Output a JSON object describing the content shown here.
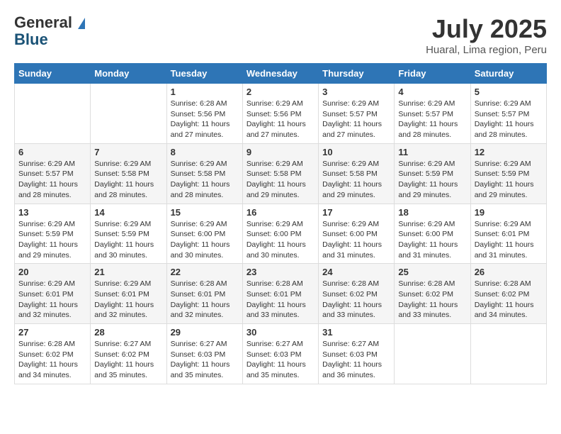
{
  "header": {
    "logo_general": "General",
    "logo_blue": "Blue",
    "month_year": "July 2025",
    "location": "Huaral, Lima region, Peru"
  },
  "weekdays": [
    "Sunday",
    "Monday",
    "Tuesday",
    "Wednesday",
    "Thursday",
    "Friday",
    "Saturday"
  ],
  "weeks": [
    [
      {
        "day": "",
        "info": ""
      },
      {
        "day": "",
        "info": ""
      },
      {
        "day": "1",
        "info": "Sunrise: 6:28 AM\nSunset: 5:56 PM\nDaylight: 11 hours and 27 minutes."
      },
      {
        "day": "2",
        "info": "Sunrise: 6:29 AM\nSunset: 5:56 PM\nDaylight: 11 hours and 27 minutes."
      },
      {
        "day": "3",
        "info": "Sunrise: 6:29 AM\nSunset: 5:57 PM\nDaylight: 11 hours and 27 minutes."
      },
      {
        "day": "4",
        "info": "Sunrise: 6:29 AM\nSunset: 5:57 PM\nDaylight: 11 hours and 28 minutes."
      },
      {
        "day": "5",
        "info": "Sunrise: 6:29 AM\nSunset: 5:57 PM\nDaylight: 11 hours and 28 minutes."
      }
    ],
    [
      {
        "day": "6",
        "info": "Sunrise: 6:29 AM\nSunset: 5:57 PM\nDaylight: 11 hours and 28 minutes."
      },
      {
        "day": "7",
        "info": "Sunrise: 6:29 AM\nSunset: 5:58 PM\nDaylight: 11 hours and 28 minutes."
      },
      {
        "day": "8",
        "info": "Sunrise: 6:29 AM\nSunset: 5:58 PM\nDaylight: 11 hours and 28 minutes."
      },
      {
        "day": "9",
        "info": "Sunrise: 6:29 AM\nSunset: 5:58 PM\nDaylight: 11 hours and 29 minutes."
      },
      {
        "day": "10",
        "info": "Sunrise: 6:29 AM\nSunset: 5:58 PM\nDaylight: 11 hours and 29 minutes."
      },
      {
        "day": "11",
        "info": "Sunrise: 6:29 AM\nSunset: 5:59 PM\nDaylight: 11 hours and 29 minutes."
      },
      {
        "day": "12",
        "info": "Sunrise: 6:29 AM\nSunset: 5:59 PM\nDaylight: 11 hours and 29 minutes."
      }
    ],
    [
      {
        "day": "13",
        "info": "Sunrise: 6:29 AM\nSunset: 5:59 PM\nDaylight: 11 hours and 29 minutes."
      },
      {
        "day": "14",
        "info": "Sunrise: 6:29 AM\nSunset: 5:59 PM\nDaylight: 11 hours and 30 minutes."
      },
      {
        "day": "15",
        "info": "Sunrise: 6:29 AM\nSunset: 6:00 PM\nDaylight: 11 hours and 30 minutes."
      },
      {
        "day": "16",
        "info": "Sunrise: 6:29 AM\nSunset: 6:00 PM\nDaylight: 11 hours and 30 minutes."
      },
      {
        "day": "17",
        "info": "Sunrise: 6:29 AM\nSunset: 6:00 PM\nDaylight: 11 hours and 31 minutes."
      },
      {
        "day": "18",
        "info": "Sunrise: 6:29 AM\nSunset: 6:00 PM\nDaylight: 11 hours and 31 minutes."
      },
      {
        "day": "19",
        "info": "Sunrise: 6:29 AM\nSunset: 6:01 PM\nDaylight: 11 hours and 31 minutes."
      }
    ],
    [
      {
        "day": "20",
        "info": "Sunrise: 6:29 AM\nSunset: 6:01 PM\nDaylight: 11 hours and 32 minutes."
      },
      {
        "day": "21",
        "info": "Sunrise: 6:29 AM\nSunset: 6:01 PM\nDaylight: 11 hours and 32 minutes."
      },
      {
        "day": "22",
        "info": "Sunrise: 6:28 AM\nSunset: 6:01 PM\nDaylight: 11 hours and 32 minutes."
      },
      {
        "day": "23",
        "info": "Sunrise: 6:28 AM\nSunset: 6:01 PM\nDaylight: 11 hours and 33 minutes."
      },
      {
        "day": "24",
        "info": "Sunrise: 6:28 AM\nSunset: 6:02 PM\nDaylight: 11 hours and 33 minutes."
      },
      {
        "day": "25",
        "info": "Sunrise: 6:28 AM\nSunset: 6:02 PM\nDaylight: 11 hours and 33 minutes."
      },
      {
        "day": "26",
        "info": "Sunrise: 6:28 AM\nSunset: 6:02 PM\nDaylight: 11 hours and 34 minutes."
      }
    ],
    [
      {
        "day": "27",
        "info": "Sunrise: 6:28 AM\nSunset: 6:02 PM\nDaylight: 11 hours and 34 minutes."
      },
      {
        "day": "28",
        "info": "Sunrise: 6:27 AM\nSunset: 6:02 PM\nDaylight: 11 hours and 35 minutes."
      },
      {
        "day": "29",
        "info": "Sunrise: 6:27 AM\nSunset: 6:03 PM\nDaylight: 11 hours and 35 minutes."
      },
      {
        "day": "30",
        "info": "Sunrise: 6:27 AM\nSunset: 6:03 PM\nDaylight: 11 hours and 35 minutes."
      },
      {
        "day": "31",
        "info": "Sunrise: 6:27 AM\nSunset: 6:03 PM\nDaylight: 11 hours and 36 minutes."
      },
      {
        "day": "",
        "info": ""
      },
      {
        "day": "",
        "info": ""
      }
    ]
  ]
}
